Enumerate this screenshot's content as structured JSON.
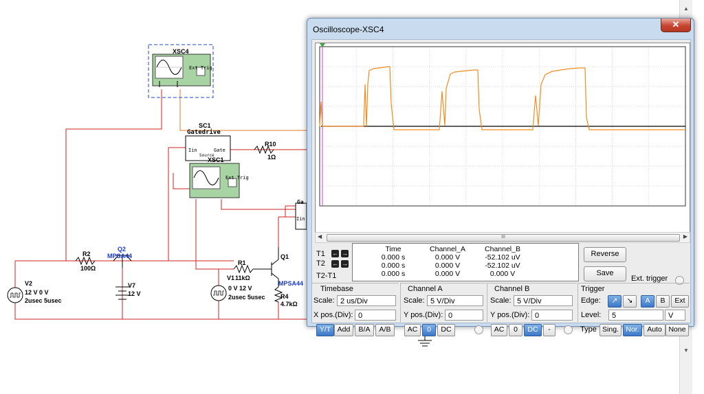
{
  "schematic": {
    "xsc4_label": "XSC4",
    "xsc1_label": "XSC1",
    "sc1_label": "SC1",
    "gatedrive_label": "Gatedrive",
    "gatedrive_in": "Iin",
    "gatedrive_gate": "Gate",
    "gatedrive_source": "Source",
    "ext_trig": "Ext Trig",
    "r10_name": "R10",
    "r10_value": "1Ω",
    "r2_name": "R2",
    "r2_value": "100Ω",
    "q2_name": "Q2",
    "q2_type": "MPSA44",
    "v7_name": "V7",
    "v7_value": "12 V",
    "v2_name": "V2",
    "v2_line1": "12 V 0 V",
    "v2_line2": "2usec 5usec",
    "r1_name": "R1",
    "r1_value": "11kΩ",
    "v1_prefix": "V1",
    "pulse_line1": "0 V 12 V",
    "pulse_line2": "2usec 5usec",
    "q1_name": "Q1",
    "q1_type": "MPSA44",
    "r4_name": "R4",
    "r4_value": "4.7kΩ",
    "ga_label": "Ga",
    "iin_short": "Iin"
  },
  "oscilloscope": {
    "title": "Oscilloscope-XSC4",
    "close_glyph": "✕",
    "scroll_thumb": "III",
    "readout": {
      "headers": [
        "",
        "Time",
        "Channel_A",
        "Channel_B"
      ],
      "rows": [
        [
          "",
          "0.000 s",
          "0.000 V",
          "-52.102 uV"
        ],
        [
          "",
          "0.000 s",
          "0.000 V",
          "-52.102 uV"
        ],
        [
          "",
          "0.000 s",
          "0.000 V",
          "0.000 V"
        ]
      ],
      "t1": "T1",
      "t2": "T2",
      "t2t1": "T2-T1"
    },
    "reverse_label": "Reverse",
    "save_label": "Save",
    "ext_trigger_label": "Ext. trigger",
    "timebase": {
      "title": "Timebase",
      "scale_label": "Scale:",
      "scale_value": "2 us/Div",
      "xpos_label": "X pos.(Div):",
      "xpos_value": "0",
      "buttons": [
        "Y/T",
        "Add",
        "B/A",
        "A/B"
      ]
    },
    "channel_a": {
      "title": "Channel A",
      "scale_label": "Scale:",
      "scale_value": "5 V/Div",
      "ypos_label": "Y pos.(Div):",
      "ypos_value": "0",
      "buttons": [
        "AC",
        "0",
        "DC"
      ]
    },
    "channel_b": {
      "title": "Channel B",
      "scale_label": "Scale:",
      "scale_value": "5 V/Div",
      "ypos_label": "Y pos.(Div):",
      "ypos_value": "0",
      "buttons": [
        "AC",
        "0",
        "DC",
        "-"
      ]
    },
    "trigger": {
      "title": "Trigger",
      "edge_label": "Edge:",
      "edge_buttons": [
        "A",
        "B",
        "Ext"
      ],
      "level_label": "Level:",
      "level_value": "5",
      "level_unit": "V",
      "type_label": "Type",
      "type_buttons": [
        "Sing.",
        "Nor.",
        "Auto",
        "None"
      ]
    }
  },
  "colors": {
    "wire_red": "#cc2020",
    "wire_orange": "#e07820",
    "trace_orange": "#f08c1e",
    "trace_black": "#000000",
    "highlight_blue": "#3c78c8",
    "component_blue": "#1a3ccc"
  }
}
